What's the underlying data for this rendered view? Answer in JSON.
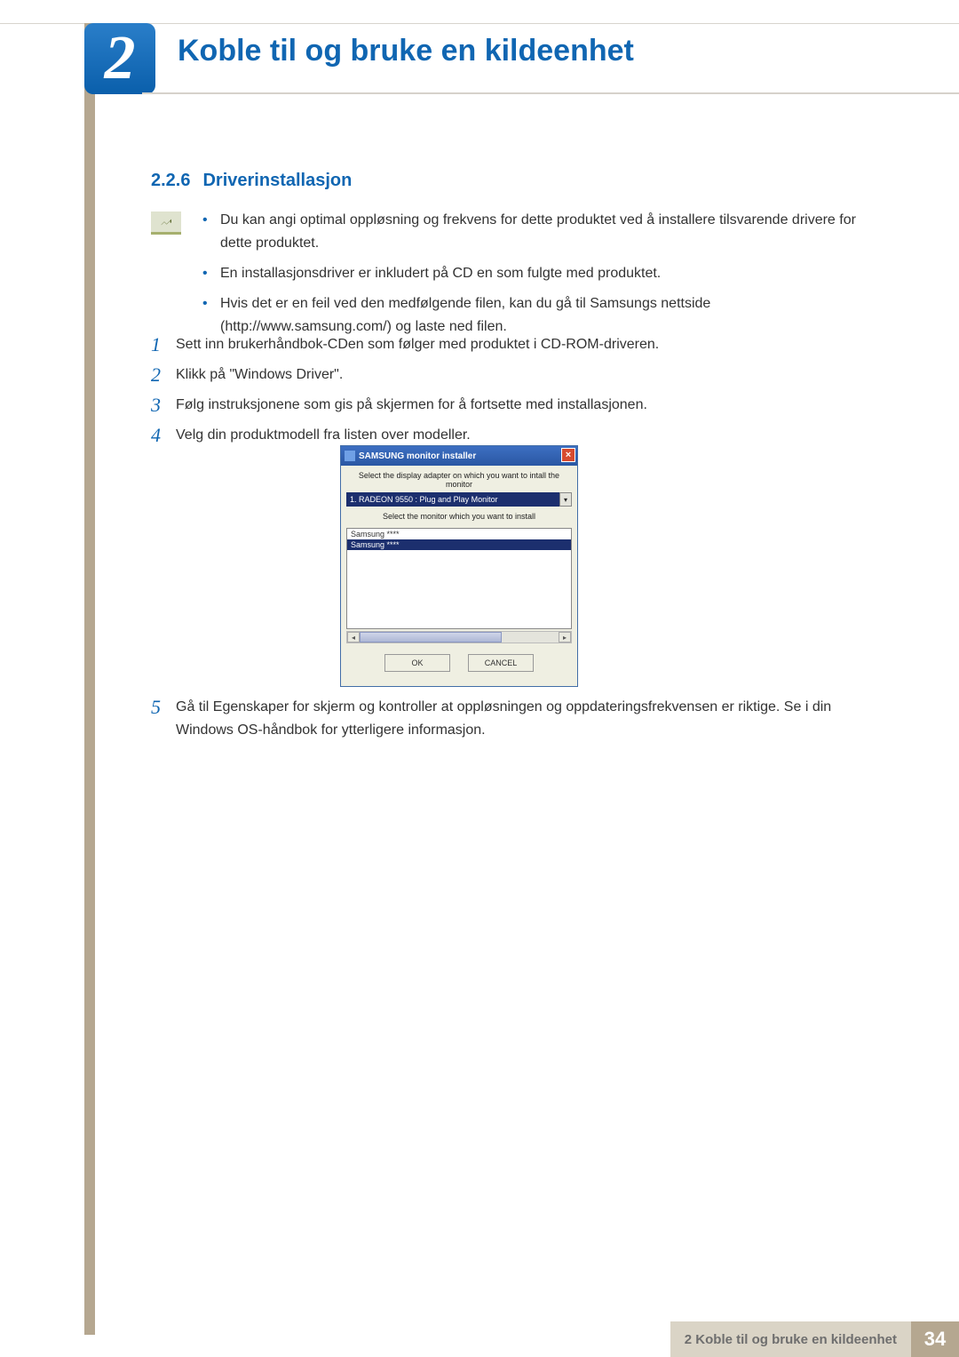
{
  "chapter": {
    "number": "2",
    "title": "Koble til og bruke en kildeenhet"
  },
  "section": {
    "number": "2.2.6",
    "title": "Driverinstallasjon"
  },
  "notes": [
    "Du kan angi optimal oppløsning og frekvens for dette produktet ved å installere tilsvarende drivere for dette produktet.",
    "En installasjonsdriver er inkludert på CD en som fulgte med produktet.",
    "Hvis det er en feil ved den medfølgende filen, kan du gå til Samsungs nettside (http://www.samsung.com/) og laste ned filen."
  ],
  "steps": {
    "s1": {
      "num": "1",
      "text": "Sett inn brukerhåndbok-CDen som følger med produktet i CD-ROM-driveren."
    },
    "s2": {
      "num": "2",
      "text": "Klikk på \"Windows Driver\"."
    },
    "s3": {
      "num": "3",
      "text": "Følg instruksjonene som gis på skjermen for å fortsette med installasjonen."
    },
    "s4": {
      "num": "4",
      "text": "Velg din produktmodell fra listen over modeller."
    },
    "s5": {
      "num": "5",
      "text": "Gå til Egenskaper for skjerm og kontroller at oppløsningen og oppdateringsfrekvensen er riktige. Se i din Windows OS-håndbok for ytterligere informasjon."
    }
  },
  "installer": {
    "title": "SAMSUNG monitor installer",
    "close": "×",
    "adapter_label": "Select the display adapter on which you want to intall the monitor",
    "adapter_value": "1. RADEON 9550 : Plug and Play Monitor",
    "monitor_label": "Select the monitor which you want to install",
    "list_item0": "Samsung ****",
    "list_item1": "Samsung ****",
    "ok": "OK",
    "cancel": "CANCEL"
  },
  "footer": {
    "label": "2 Koble til og bruke en kildeenhet",
    "page": "34"
  }
}
